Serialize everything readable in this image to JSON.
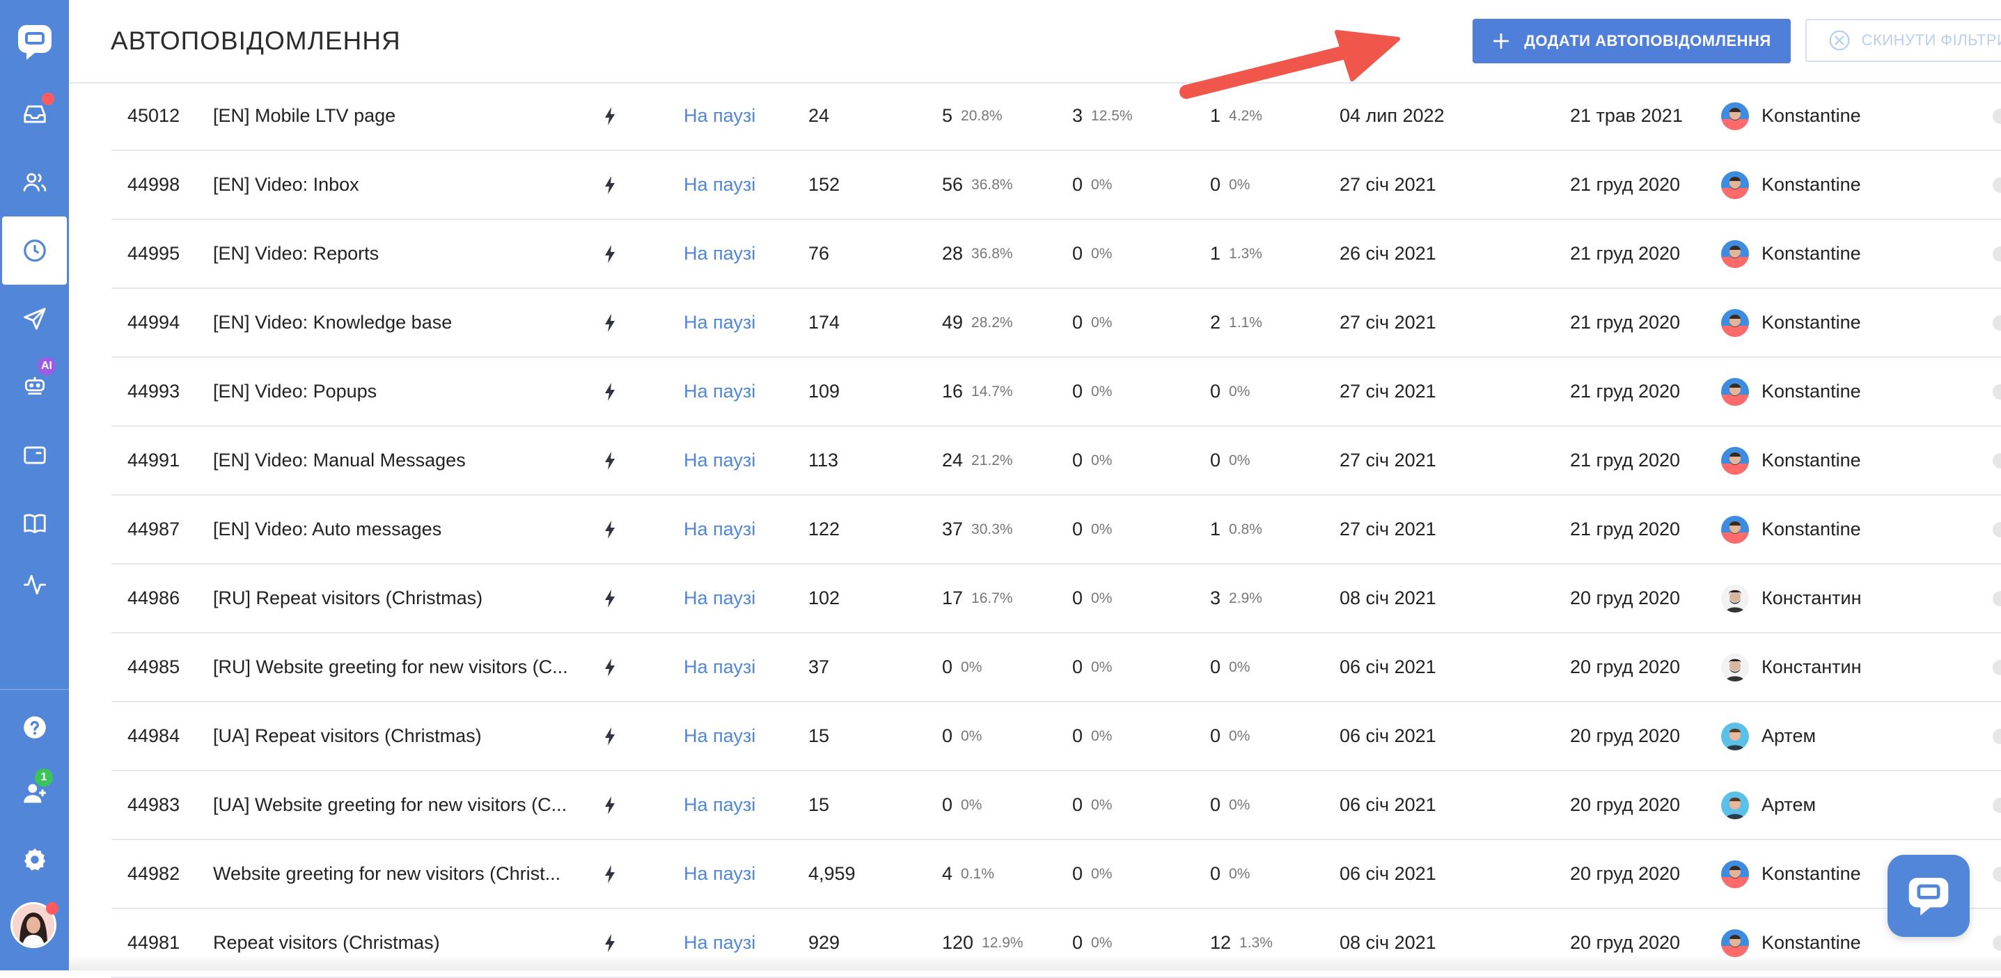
{
  "header": {
    "title": "АВТОПОВІДОМЛЕННЯ",
    "add_button_label": "ДОДАТИ АВТОПОВІДОМЛЕННЯ",
    "reset_button_label": "СКИНУТИ ФІЛЬТРИ"
  },
  "sidebar": {
    "items": [
      {
        "icon": "logo-chat-icon"
      },
      {
        "icon": "inbox-icon",
        "has_notification": true
      },
      {
        "icon": "users-icon"
      },
      {
        "icon": "clock-icon",
        "active": true
      },
      {
        "icon": "send-icon"
      },
      {
        "icon": "bot-icon",
        "badge": "AI"
      },
      {
        "icon": "wallet-icon"
      },
      {
        "icon": "book-icon"
      },
      {
        "icon": "activity-icon"
      },
      {
        "icon": "help-icon"
      },
      {
        "icon": "team-icon",
        "badge": "1"
      },
      {
        "icon": "settings-icon"
      },
      {
        "icon": "user-avatar"
      }
    ],
    "ai_badge": "AI",
    "team_badge": "1"
  },
  "colors": {
    "sidebar": "#5286d8",
    "primary_button": "#4f7fd8",
    "status_link": "#4f86d9",
    "notification": "#ff5a5f",
    "badge_ai": "#a05be6",
    "badge_count": "#3cc35a",
    "arrow": "#f0574a"
  },
  "table": {
    "rows": [
      {
        "id": "45012",
        "title": "[EN] Mobile LTV page",
        "status": "На паузі",
        "sent": "24",
        "m1": "5",
        "m1_pct": "20.8%",
        "m2": "3",
        "m2_pct": "12.5%",
        "m3": "1",
        "m3_pct": "4.2%",
        "date1": "04 лип 2022",
        "date2": "21 трав 2021",
        "author": "Konstantine"
      },
      {
        "id": "44998",
        "title": "[EN] Video: Inbox",
        "status": "На паузі",
        "sent": "152",
        "m1": "56",
        "m1_pct": "36.8%",
        "m2": "0",
        "m2_pct": "0%",
        "m3": "0",
        "m3_pct": "0%",
        "date1": "27 січ 2021",
        "date2": "21 груд 2020",
        "author": "Konstantine"
      },
      {
        "id": "44995",
        "title": "[EN] Video: Reports",
        "status": "На паузі",
        "sent": "76",
        "m1": "28",
        "m1_pct": "36.8%",
        "m2": "0",
        "m2_pct": "0%",
        "m3": "1",
        "m3_pct": "1.3%",
        "date1": "26 січ 2021",
        "date2": "21 груд 2020",
        "author": "Konstantine"
      },
      {
        "id": "44994",
        "title": "[EN] Video: Knowledge base",
        "status": "На паузі",
        "sent": "174",
        "m1": "49",
        "m1_pct": "28.2%",
        "m2": "0",
        "m2_pct": "0%",
        "m3": "2",
        "m3_pct": "1.1%",
        "date1": "27 січ 2021",
        "date2": "21 груд 2020",
        "author": "Konstantine"
      },
      {
        "id": "44993",
        "title": "[EN] Video: Popups",
        "status": "На паузі",
        "sent": "109",
        "m1": "16",
        "m1_pct": "14.7%",
        "m2": "0",
        "m2_pct": "0%",
        "m3": "0",
        "m3_pct": "0%",
        "date1": "27 січ 2021",
        "date2": "21 груд 2020",
        "author": "Konstantine"
      },
      {
        "id": "44991",
        "title": "[EN] Video: Manual Messages",
        "status": "На паузі",
        "sent": "113",
        "m1": "24",
        "m1_pct": "21.2%",
        "m2": "0",
        "m2_pct": "0%",
        "m3": "0",
        "m3_pct": "0%",
        "date1": "27 січ 2021",
        "date2": "21 груд 2020",
        "author": "Konstantine"
      },
      {
        "id": "44987",
        "title": "[EN] Video: Auto messages",
        "status": "На паузі",
        "sent": "122",
        "m1": "37",
        "m1_pct": "30.3%",
        "m2": "0",
        "m2_pct": "0%",
        "m3": "1",
        "m3_pct": "0.8%",
        "date1": "27 січ 2021",
        "date2": "21 груд 2020",
        "author": "Konstantine"
      },
      {
        "id": "44986",
        "title": "[RU] Repeat visitors (Christmas)",
        "status": "На паузі",
        "sent": "102",
        "m1": "17",
        "m1_pct": "16.7%",
        "m2": "0",
        "m2_pct": "0%",
        "m3": "3",
        "m3_pct": "2.9%",
        "date1": "08 січ 2021",
        "date2": "20 груд 2020",
        "author": "Константин"
      },
      {
        "id": "44985",
        "title": "[RU] Website greeting for new visitors (C...",
        "status": "На паузі",
        "sent": "37",
        "m1": "0",
        "m1_pct": "0%",
        "m2": "0",
        "m2_pct": "0%",
        "m3": "0",
        "m3_pct": "0%",
        "date1": "06 січ 2021",
        "date2": "20 груд 2020",
        "author": "Константин"
      },
      {
        "id": "44984",
        "title": "[UA] Repeat visitors (Christmas)",
        "status": "На паузі",
        "sent": "15",
        "m1": "0",
        "m1_pct": "0%",
        "m2": "0",
        "m2_pct": "0%",
        "m3": "0",
        "m3_pct": "0%",
        "date1": "06 січ 2021",
        "date2": "20 груд 2020",
        "author": "Артем"
      },
      {
        "id": "44983",
        "title": "[UA] Website greeting for new visitors (C...",
        "status": "На паузі",
        "sent": "15",
        "m1": "0",
        "m1_pct": "0%",
        "m2": "0",
        "m2_pct": "0%",
        "m3": "0",
        "m3_pct": "0%",
        "date1": "06 січ 2021",
        "date2": "20 груд 2020",
        "author": "Артем"
      },
      {
        "id": "44982",
        "title": "Website greeting for new visitors (Christ...",
        "status": "На паузі",
        "sent": "4,959",
        "m1": "4",
        "m1_pct": "0.1%",
        "m2": "0",
        "m2_pct": "0%",
        "m3": "0",
        "m3_pct": "0%",
        "date1": "06 січ 2021",
        "date2": "20 груд 2020",
        "author": "Konstantine"
      },
      {
        "id": "44981",
        "title": "Repeat visitors (Christmas)",
        "status": "На паузі",
        "sent": "929",
        "m1": "120",
        "m1_pct": "12.9%",
        "m2": "0",
        "m2_pct": "0%",
        "m3": "12",
        "m3_pct": "1.3%",
        "date1": "08 січ 2021",
        "date2": "20 груд 2020",
        "author": "Konstantine"
      }
    ]
  }
}
